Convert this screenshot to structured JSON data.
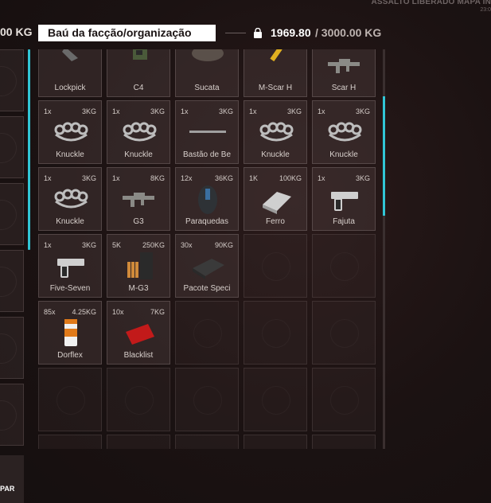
{
  "topbar": {
    "notice": "ASSALTO LIBERADO MAPA IN",
    "time": "23:0"
  },
  "header": {
    "left_weight": "00 KG",
    "title": "Baú da facção/organização",
    "weight_current": "1969.80",
    "weight_max": "/ 3000.00 KG"
  },
  "inventory": {
    "items": [
      {
        "name": "Lockpick",
        "qty": "",
        "weight": "",
        "icon": "lockpick-icon"
      },
      {
        "name": "C4",
        "qty": "",
        "weight": "",
        "icon": "c4-icon"
      },
      {
        "name": "Sucata",
        "qty": "",
        "weight": "",
        "icon": "scrap-icon"
      },
      {
        "name": "M-Scar H",
        "qty": "",
        "weight": "",
        "icon": "ammo-icon"
      },
      {
        "name": "Scar H",
        "qty": "",
        "weight": "",
        "icon": "rifle-icon"
      },
      {
        "name": "Knuckle",
        "qty": "1x",
        "weight": "3KG",
        "icon": "knuckle-icon"
      },
      {
        "name": "Knuckle",
        "qty": "1x",
        "weight": "3KG",
        "icon": "knuckle-icon"
      },
      {
        "name": "Bastão de Be",
        "qty": "1x",
        "weight": "3KG",
        "icon": "bat-icon"
      },
      {
        "name": "Knuckle",
        "qty": "1x",
        "weight": "3KG",
        "icon": "knuckle-icon"
      },
      {
        "name": "Knuckle",
        "qty": "1x",
        "weight": "3KG",
        "icon": "knuckle-icon"
      },
      {
        "name": "Knuckle",
        "qty": "1x",
        "weight": "3KG",
        "icon": "knuckle-icon"
      },
      {
        "name": "G3",
        "qty": "1x",
        "weight": "8KG",
        "icon": "rifle-icon"
      },
      {
        "name": "Paraquedas",
        "qty": "12x",
        "weight": "36KG",
        "icon": "parachute-icon"
      },
      {
        "name": "Ferro",
        "qty": "1K",
        "weight": "100KG",
        "icon": "iron-icon"
      },
      {
        "name": "Fajuta",
        "qty": "1x",
        "weight": "3KG",
        "icon": "pistol-icon"
      },
      {
        "name": "Five-Seven",
        "qty": "1x",
        "weight": "3KG",
        "icon": "pistol-icon"
      },
      {
        "name": "M-G3",
        "qty": "5K",
        "weight": "250KG",
        "icon": "ammo-box-icon"
      },
      {
        "name": "Pacote Speci",
        "qty": "30x",
        "weight": "90KG",
        "icon": "case-icon"
      },
      {
        "name": "",
        "qty": "",
        "weight": "",
        "icon": ""
      },
      {
        "name": "",
        "qty": "",
        "weight": "",
        "icon": ""
      },
      {
        "name": "Dorflex",
        "qty": "85x",
        "weight": "4.25KG",
        "icon": "pills-icon"
      },
      {
        "name": "Blacklist",
        "qty": "10x",
        "weight": "7KG",
        "icon": "blacklist-icon"
      }
    ]
  },
  "left_panel": {
    "button_label": "PAR"
  },
  "colors": {
    "accent": "#31c6d6",
    "title_bg": "#ffffff"
  }
}
